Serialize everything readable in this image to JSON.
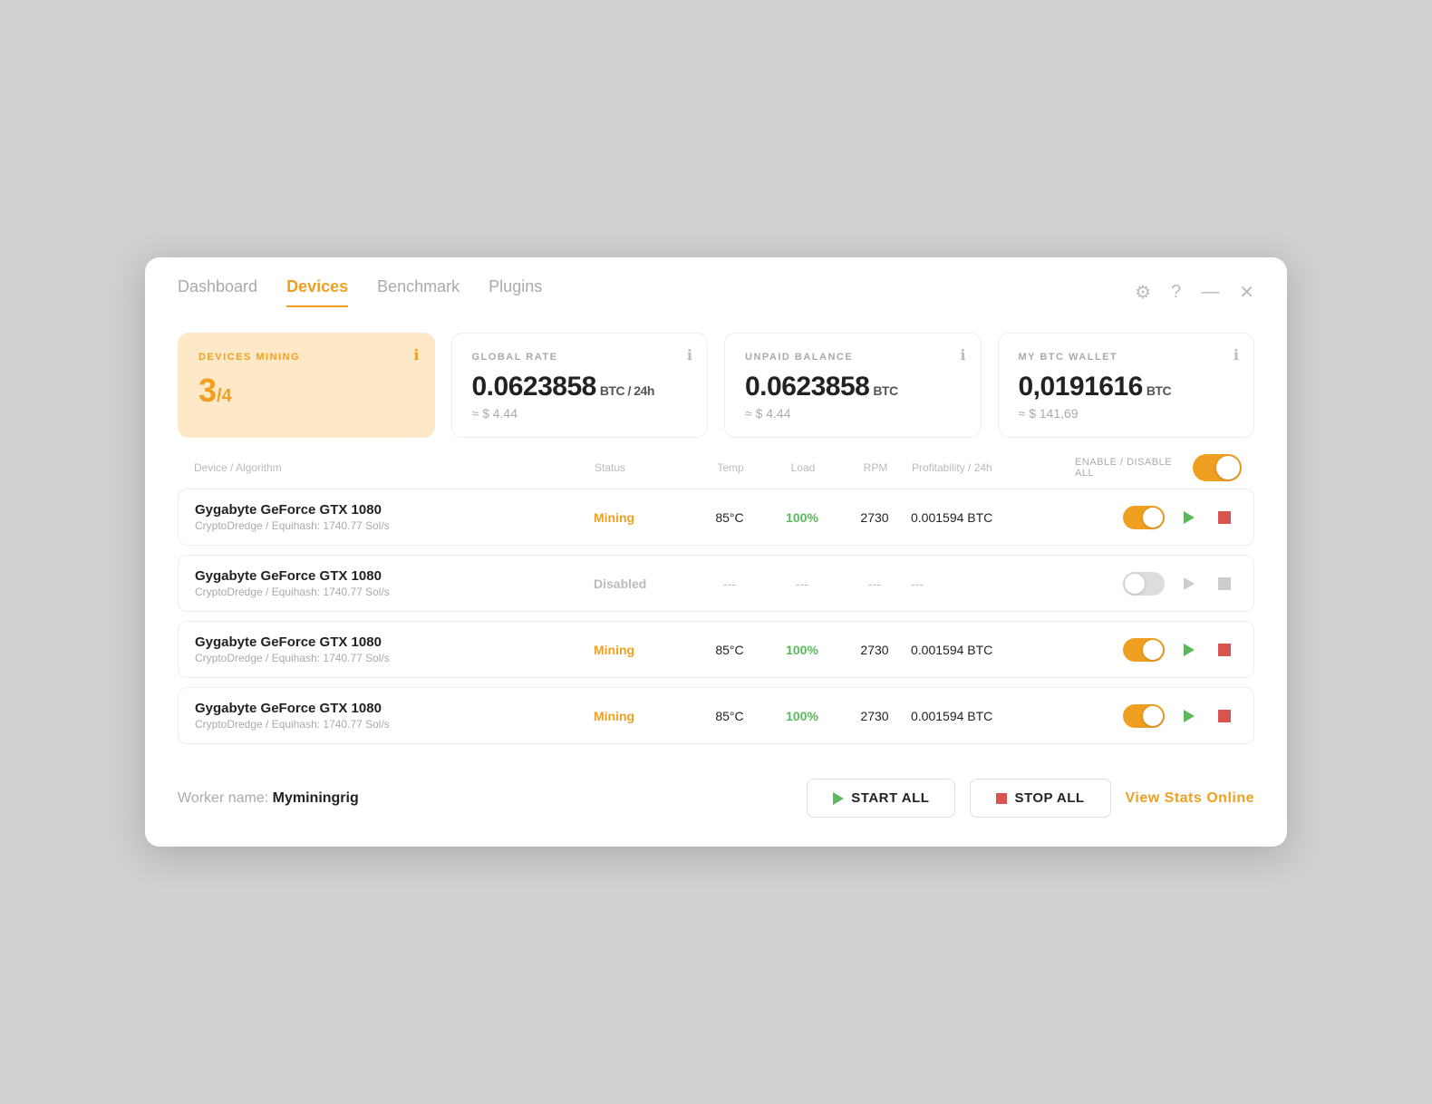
{
  "nav": {
    "tabs": [
      {
        "id": "dashboard",
        "label": "Dashboard",
        "active": false
      },
      {
        "id": "devices",
        "label": "Devices",
        "active": true
      },
      {
        "id": "benchmark",
        "label": "Benchmark",
        "active": false
      },
      {
        "id": "plugins",
        "label": "Plugins",
        "active": false
      }
    ]
  },
  "stats": {
    "devices_mining": {
      "label": "DEVICES MINING",
      "value": "3",
      "total": "/4"
    },
    "global_rate": {
      "label": "GLOBAL RATE",
      "value": "0.0623858",
      "unit": "BTC / 24h",
      "usd": "≈ $ 4.44"
    },
    "unpaid_balance": {
      "label": "UNPAID BALANCE",
      "value": "0.0623858",
      "unit": "BTC",
      "usd": "≈ $ 4.44"
    },
    "my_btc_wallet": {
      "label": "MY BTC WALLET",
      "value": "0,0191616",
      "unit": "BTC",
      "usd": "≈ $ 141,69"
    }
  },
  "table": {
    "headers": {
      "device": "Device / Algorithm",
      "status": "Status",
      "temp": "Temp",
      "load": "Load",
      "rpm": "RPM",
      "profitability": "Profitability / 24h",
      "enable_disable": "ENABLE / DISABLE ALL"
    },
    "rows": [
      {
        "id": 1,
        "name": "Gygabyte GeForce GTX 1080",
        "algo": "CryptoDredge / Equihash: 1740.77 Sol/s",
        "status": "Mining",
        "status_type": "mining",
        "temp": "85°C",
        "load": "100%",
        "rpm": "2730",
        "profitability": "0.001594 BTC",
        "enabled": true
      },
      {
        "id": 2,
        "name": "Gygabyte GeForce GTX 1080",
        "algo": "CryptoDredge / Equihash: 1740.77 Sol/s",
        "status": "Disabled",
        "status_type": "disabled",
        "temp": "---",
        "load": "---",
        "rpm": "---",
        "profitability": "---",
        "enabled": false
      },
      {
        "id": 3,
        "name": "Gygabyte GeForce GTX 1080",
        "algo": "CryptoDredge / Equihash: 1740.77 Sol/s",
        "status": "Mining",
        "status_type": "mining",
        "temp": "85°C",
        "load": "100%",
        "rpm": "2730",
        "profitability": "0.001594 BTC",
        "enabled": true
      },
      {
        "id": 4,
        "name": "Gygabyte GeForce GTX 1080",
        "algo": "CryptoDredge / Equihash: 1740.77 Sol/s",
        "status": "Mining",
        "status_type": "mining",
        "temp": "85°C",
        "load": "100%",
        "rpm": "2730",
        "profitability": "0.001594 BTC",
        "enabled": true
      }
    ]
  },
  "footer": {
    "worker_label": "Worker name:",
    "worker_name": "Myminingrig",
    "start_all": "START ALL",
    "stop_all": "STOP ALL",
    "view_stats": "View Stats Online"
  }
}
